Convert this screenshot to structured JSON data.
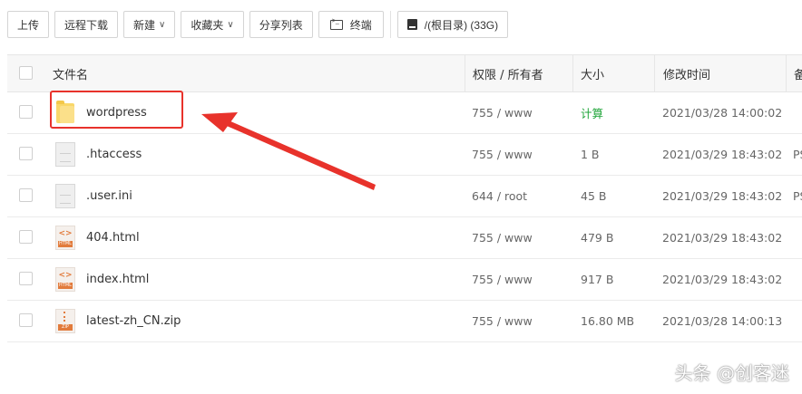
{
  "toolbar": {
    "upload": "上传",
    "remote_download": "远程下载",
    "new": "新建",
    "favorites": "收藏夹",
    "share_list": "分享列表",
    "terminal": "终端",
    "path": "/(根目录) (33G)"
  },
  "table": {
    "headers": {
      "name": "文件名",
      "perm": "权限 / 所有者",
      "size": "大小",
      "mtime": "修改时间",
      "extra": "备"
    },
    "rows": [
      {
        "icon": "folder-icon",
        "name": "wordpress",
        "perm": "755 / www",
        "size": "计算",
        "mtime": "2021/03/28 14:00:02",
        "extra": ""
      },
      {
        "icon": "file-icon",
        "name": ".htaccess",
        "perm": "755 / www",
        "size": "1 B",
        "mtime": "2021/03/29 18:43:02",
        "extra": "PS"
      },
      {
        "icon": "file-icon",
        "name": ".user.ini",
        "perm": "644 / root",
        "size": "45 B",
        "mtime": "2021/03/29 18:43:02",
        "extra": "PS"
      },
      {
        "icon": "html-file-icon",
        "name": "404.html",
        "perm": "755 / www",
        "size": "479 B",
        "mtime": "2021/03/29 18:43:02",
        "extra": ""
      },
      {
        "icon": "html-file-icon",
        "name": "index.html",
        "perm": "755 / www",
        "size": "917 B",
        "mtime": "2021/03/29 18:43:02",
        "extra": ""
      },
      {
        "icon": "zip-file-icon",
        "name": "latest-zh_CN.zip",
        "perm": "755 / www",
        "size": "16.80 MB",
        "mtime": "2021/03/28 14:00:13",
        "extra": ""
      }
    ]
  },
  "icons": {
    "html_label": "HTML",
    "zip_label": "ZIP",
    "code_glyph": "<>"
  },
  "colors": {
    "highlight": "#e8322b",
    "calc_text": "#20a53a",
    "folder": "#f9d769"
  },
  "watermark": "头条 @创客迷"
}
